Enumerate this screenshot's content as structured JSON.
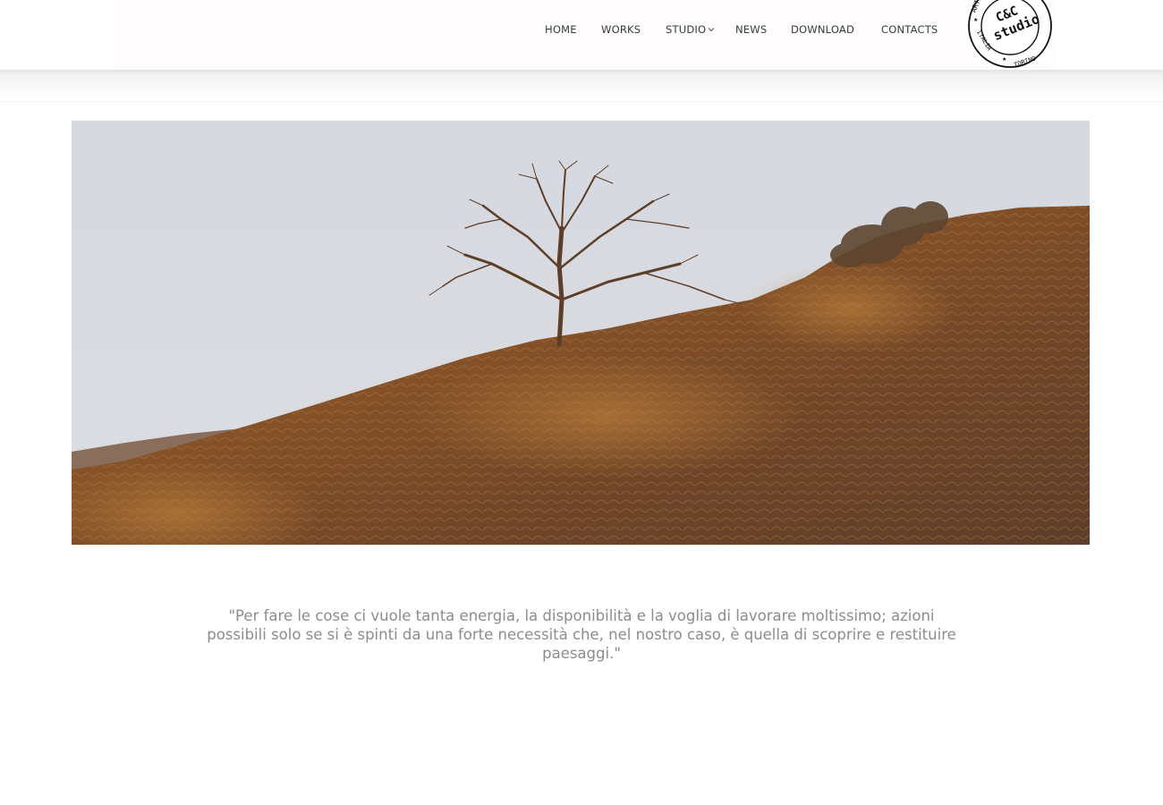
{
  "header": {
    "nav": [
      {
        "label": "HOME",
        "name": "nav-home"
      },
      {
        "label": "WORKS",
        "name": "nav-works"
      },
      {
        "label": "STUDIO",
        "name": "nav-studio",
        "has_dropdown": true
      },
      {
        "label": "NEWS",
        "name": "nav-news"
      },
      {
        "label": "DOWNLOAD",
        "name": "nav-download"
      },
      {
        "label": "CONTACTS",
        "name": "nav-contacts"
      }
    ],
    "dropdown_icon": "chevron-down-icon"
  },
  "logo": {
    "center_line1": "C&C",
    "center_line2": "studio",
    "ring_left": "ARTE",
    "ring_left2": "ITALIA",
    "ring_right": "TORINO"
  },
  "hero": {
    "image": "hillside landscape with tree, rusted metal artwork"
  },
  "quote": {
    "text": "\"Per fare le cose ci vuole tanta energia, la disponibilità e la voglia di lavorare moltissimo; azioni possibili solo se si è spinti da una forte necessità che, nel nostro caso, è quella di scoprire e restituire paesaggi.\""
  },
  "colors": {
    "nav_text": "#3a3a3a",
    "quote_text": "#8c8c8c",
    "sky": "#d7d9df",
    "rust_dark": "#6a4428",
    "rust_light": "#b9773a"
  }
}
